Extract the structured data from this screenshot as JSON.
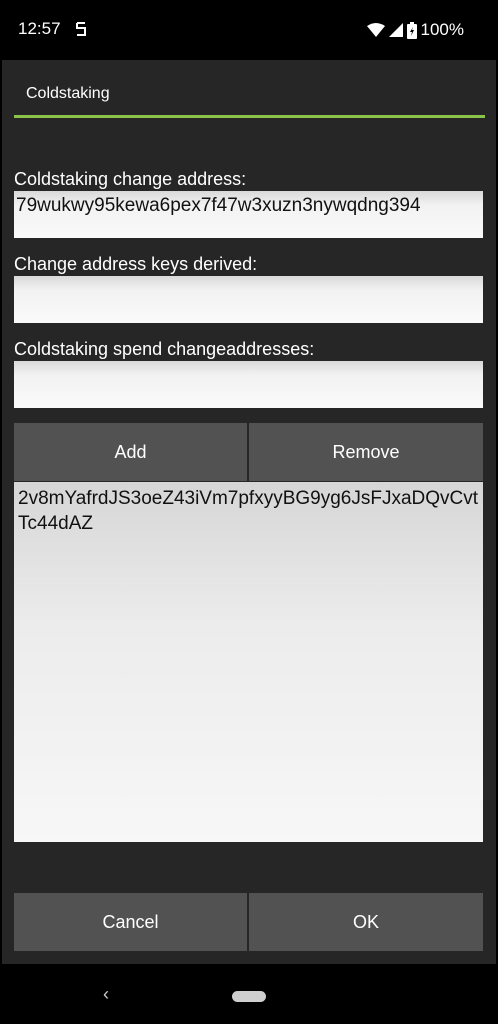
{
  "status_bar": {
    "time": "12:57",
    "battery_percent": "100%",
    "icons": [
      "app-notification-icon",
      "wifi-icon",
      "cell-signal-icon",
      "battery-icon"
    ]
  },
  "dialog": {
    "title": "Coldstaking",
    "accent_color": "#8bc34a",
    "change_address_label": "Coldstaking change address:",
    "change_address_value": "79wukwy95kewa6pex7f47w3xuzn3nywqdng394",
    "keys_derived_label": "Change address keys derived:",
    "keys_derived_value": "",
    "spend_label": "Coldstaking spend changeaddresses:",
    "spend_value": "",
    "add_label": "Add",
    "remove_label": "Remove",
    "list_items": [
      "2v8mYafrdJS3oeZ43iVm7pfxyyBG9yg6JsFJxaDQvCvtTc44dAZ"
    ],
    "cancel_label": "Cancel",
    "ok_label": "OK"
  },
  "nav_bar": {
    "back_glyph": "‹"
  }
}
